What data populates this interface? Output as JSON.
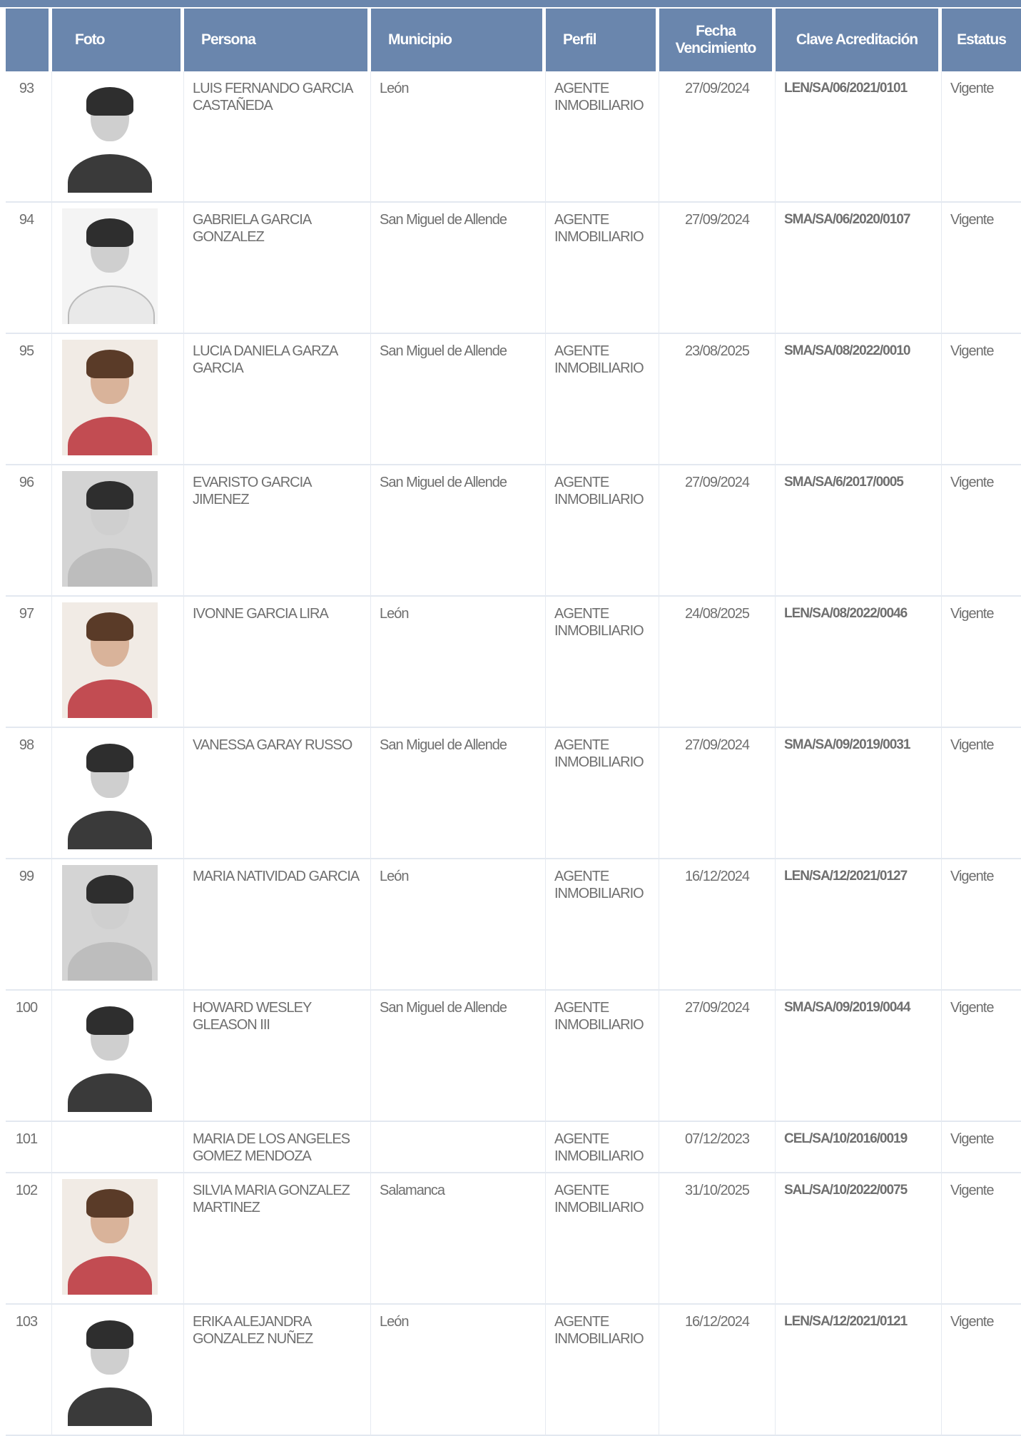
{
  "columns": {
    "num": "",
    "foto": "Foto",
    "persona": "Persona",
    "municipio": "Municipio",
    "perfil": "Perfil",
    "fecha": "Fecha Vencimiento",
    "clave": "Clave Acreditación",
    "estatus": "Estatus"
  },
  "rows": [
    {
      "num": "93",
      "persona": "LUIS FERNANDO GARCIA CASTAÑEDA",
      "municipio": "León",
      "perfil": "AGENTE INMOBILIARIO",
      "fecha": "27/09/2024",
      "clave": "LEN/SA/06/2021/0101",
      "estatus": "Vigente"
    },
    {
      "num": "94",
      "persona": "GABRIELA GARCIA GONZALEZ",
      "municipio": "San Miguel de Allende",
      "perfil": "AGENTE INMOBILIARIO",
      "fecha": "27/09/2024",
      "clave": "SMA/SA/06/2020/0107",
      "estatus": "Vigente"
    },
    {
      "num": "95",
      "persona": "LUCIA DANIELA GARZA GARCIA",
      "municipio": "San Miguel de Allende",
      "perfil": "AGENTE INMOBILIARIO",
      "fecha": "23/08/2025",
      "clave": "SMA/SA/08/2022/0010",
      "estatus": "Vigente"
    },
    {
      "num": "96",
      "persona": "EVARISTO GARCIA JIMENEZ",
      "municipio": "San Miguel de Allende",
      "perfil": "AGENTE INMOBILIARIO",
      "fecha": "27/09/2024",
      "clave": "SMA/SA/6/2017/0005",
      "estatus": "Vigente"
    },
    {
      "num": "97",
      "persona": "IVONNE GARCIA LIRA",
      "municipio": "León",
      "perfil": "AGENTE INMOBILIARIO",
      "fecha": "24/08/2025",
      "clave": "LEN/SA/08/2022/0046",
      "estatus": "Vigente"
    },
    {
      "num": "98",
      "persona": "VANESSA GARAY RUSSO",
      "municipio": "San Miguel de Allende",
      "perfil": "AGENTE INMOBILIARIO",
      "fecha": "27/09/2024",
      "clave": "SMA/SA/09/2019/0031",
      "estatus": "Vigente"
    },
    {
      "num": "99",
      "persona": "MARIA NATIVIDAD GARCIA",
      "municipio": "León",
      "perfil": "AGENTE INMOBILIARIO",
      "fecha": "16/12/2024",
      "clave": "LEN/SA/12/2021/0127",
      "estatus": "Vigente"
    },
    {
      "num": "100",
      "persona": "HOWARD WESLEY GLEASON III",
      "municipio": "San Miguel de Allende",
      "perfil": "AGENTE INMOBILIARIO",
      "fecha": "27/09/2024",
      "clave": "SMA/SA/09/2019/0044",
      "estatus": "Vigente"
    },
    {
      "num": "101",
      "persona": "MARIA DE LOS ANGELES GOMEZ MENDOZA",
      "municipio": "",
      "perfil": "AGENTE INMOBILIARIO",
      "fecha": "07/12/2023",
      "clave": "CEL/SA/10/2016/0019",
      "estatus": "Vigente"
    },
    {
      "num": "102",
      "persona": "SILVIA MARIA GONZALEZ MARTINEZ",
      "municipio": "Salamanca",
      "perfil": "AGENTE INMOBILIARIO",
      "fecha": "31/10/2025",
      "clave": "SAL/SA/10/2022/0075",
      "estatus": "Vigente"
    },
    {
      "num": "103",
      "persona": "ERIKA ALEJANDRA GONZALEZ NUÑEZ",
      "municipio": "León",
      "perfil": "AGENTE INMOBILIARIO",
      "fecha": "16/12/2024",
      "clave": "LEN/SA/12/2021/0121",
      "estatus": "Vigente"
    }
  ],
  "colors": {
    "header_bg": "#6a86ad",
    "header_text": "#ffffff",
    "cell_text": "#6f6f6f",
    "row_border": "#e3e8f0"
  }
}
